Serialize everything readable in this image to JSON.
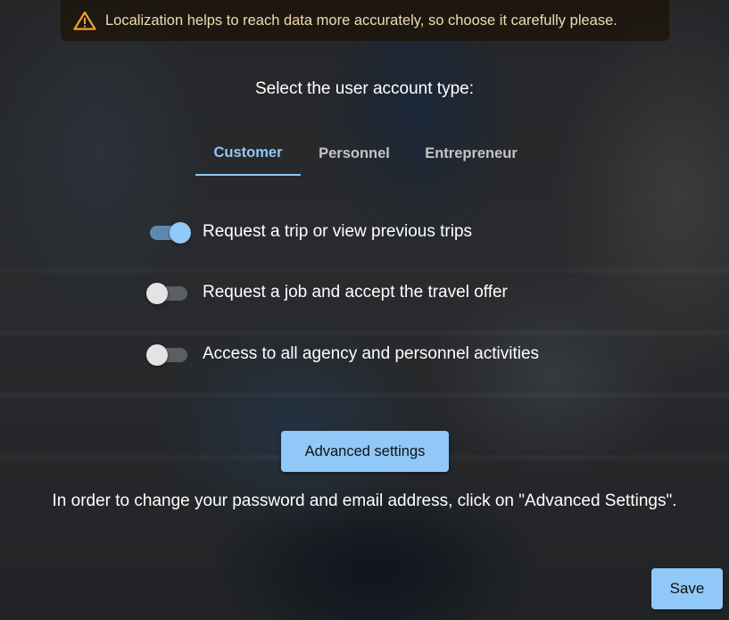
{
  "banner": {
    "icon": "warning-icon",
    "message": "Localization helps to reach data more accurately, so choose it carefully please.",
    "accent_color": "#f0a030"
  },
  "account_type": {
    "title": "Select the user account type:",
    "tabs": [
      {
        "label": "Customer",
        "active": true
      },
      {
        "label": "Personnel",
        "active": false
      },
      {
        "label": "Entrepreneur",
        "active": false
      }
    ]
  },
  "permissions": [
    {
      "label": "Request a trip or view previous trips",
      "enabled": true
    },
    {
      "label": "Request a job and accept the travel offer",
      "enabled": false
    },
    {
      "label": "Access to all agency and personnel activities",
      "enabled": false
    }
  ],
  "advanced_button_label": "Advanced settings",
  "info_text": "In order to change your password and email address, click on \"Advanced Settings\".",
  "save_button_label": "Save",
  "colors": {
    "accent": "#90c8f8",
    "banner_text": "#f2d9b3"
  }
}
